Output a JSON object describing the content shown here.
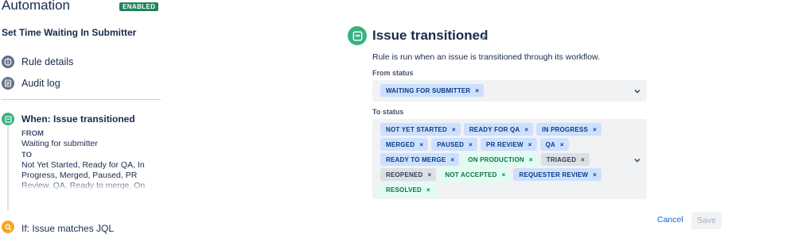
{
  "app": {
    "title": "Automation",
    "status_badge": "ENABLED"
  },
  "sidebar": {
    "rule_name": "Set Time Waiting In Submitter",
    "nav": [
      {
        "label": "Rule details",
        "icon": "info-icon"
      },
      {
        "label": "Audit log",
        "icon": "document-icon"
      }
    ],
    "trigger": {
      "title": "When: Issue transitioned",
      "from_caption": "FROM",
      "from_value": "Waiting for submitter",
      "to_caption": "TO",
      "to_value": "Not Yet Started, Ready for QA, In Progress, Merged, Paused, PR Review, QA, Ready to merge, On Production,"
    },
    "condition": {
      "title": "If: Issue matches JQL"
    }
  },
  "main": {
    "title": "Issue transitioned",
    "description": "Rule is run when an issue is transitioned through its workflow.",
    "from_status": {
      "label": "From status",
      "tags": [
        {
          "text": "WAITING FOR SUBMITTER",
          "color": "blue"
        }
      ]
    },
    "to_status": {
      "label": "To status",
      "tags": [
        {
          "text": "NOT YET STARTED",
          "color": "blue"
        },
        {
          "text": "READY FOR QA",
          "color": "blue"
        },
        {
          "text": "IN PROGRESS",
          "color": "blue"
        },
        {
          "text": "MERGED",
          "color": "blue"
        },
        {
          "text": "PAUSED",
          "color": "blue"
        },
        {
          "text": "PR REVIEW",
          "color": "blue"
        },
        {
          "text": "QA",
          "color": "blue"
        },
        {
          "text": "READY TO MERGE",
          "color": "blue"
        },
        {
          "text": "ON PRODUCTION",
          "color": "green"
        },
        {
          "text": "TRIAGED",
          "color": "grey"
        },
        {
          "text": "REOPENED",
          "color": "grey"
        },
        {
          "text": "NOT ACCEPTED",
          "color": "green"
        },
        {
          "text": "REQUESTER REVIEW",
          "color": "blue"
        },
        {
          "text": "RESOLVED",
          "color": "green"
        }
      ]
    },
    "actions": {
      "cancel": "Cancel",
      "save": "Save"
    }
  },
  "colors": {
    "accent_green": "#36b37e",
    "badge_green": "#1f845a",
    "tag_blue": "#cce0ff",
    "tag_green": "#dcfff1",
    "tag_grey": "#dcdfe4",
    "link_blue": "#0c66e4",
    "condition_orange": "#f5a623"
  }
}
